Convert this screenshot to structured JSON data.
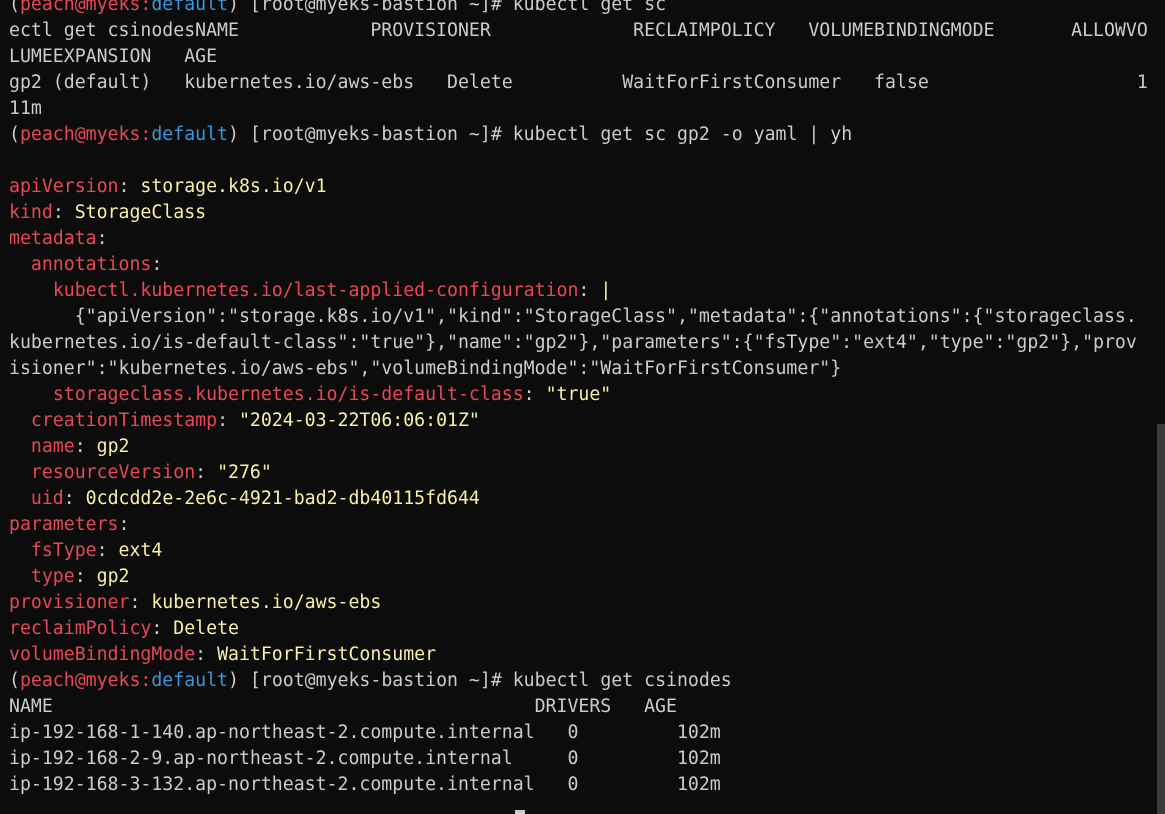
{
  "prompt": {
    "user": "peach",
    "at": "@",
    "host": "myeks",
    "colon": ":",
    "ns": "default",
    "shell": "[root@myeks-bastion ~]#"
  },
  "lines": [
    {
      "type": "prompt",
      "cmd": "kubectl get sc"
    },
    {
      "type": "plain",
      "text": "ectl get csinodesNAME            PROVISIONER             RECLAIMPOLICY   VOLUMEBINDINGMODE       ALLOWVO"
    },
    {
      "type": "plain",
      "text": "LUMEEXPANSION   AGE"
    },
    {
      "type": "plain",
      "text": "gp2 (default)   kubernetes.io/aws-ebs   Delete          WaitForFirstConsumer   false                   1"
    },
    {
      "type": "plain",
      "text": "11m"
    },
    {
      "type": "prompt",
      "cmd": "kubectl get sc gp2 -o yaml | yh"
    },
    {
      "type": "plain",
      "text": ""
    },
    {
      "type": "kv",
      "indent": "",
      "key": "apiVersion",
      "value": "storage.k8s.io/v1"
    },
    {
      "type": "kv",
      "indent": "",
      "key": "kind",
      "value": "StorageClass"
    },
    {
      "type": "kv",
      "indent": "",
      "key": "metadata",
      "value": ""
    },
    {
      "type": "kv",
      "indent": "  ",
      "key": "annotations",
      "value": ""
    },
    {
      "type": "kv",
      "indent": "    ",
      "key": "kubectl.kubernetes.io/last-applied-configuration",
      "value": "|"
    },
    {
      "type": "plain",
      "text": "      {\"apiVersion\":\"storage.k8s.io/v1\",\"kind\":\"StorageClass\",\"metadata\":{\"annotations\":{\"storageclass."
    },
    {
      "type": "plain",
      "text": "kubernetes.io/is-default-class\":\"true\"},\"name\":\"gp2\"},\"parameters\":{\"fsType\":\"ext4\",\"type\":\"gp2\"},\"prov"
    },
    {
      "type": "plain",
      "text": "isioner\":\"kubernetes.io/aws-ebs\",\"volumeBindingMode\":\"WaitForFirstConsumer\"}"
    },
    {
      "type": "kv",
      "indent": "    ",
      "key": "storageclass.kubernetes.io/is-default-class",
      "value": "\"true\""
    },
    {
      "type": "kv",
      "indent": "  ",
      "key": "creationTimestamp",
      "value": "\"2024-03-22T06:06:01Z\""
    },
    {
      "type": "kv",
      "indent": "  ",
      "key": "name",
      "value": "gp2"
    },
    {
      "type": "kv",
      "indent": "  ",
      "key": "resourceVersion",
      "value": "\"276\""
    },
    {
      "type": "kv",
      "indent": "  ",
      "key": "uid",
      "value": "0cdcdd2e-2e6c-4921-bad2-db40115fd644"
    },
    {
      "type": "kv",
      "indent": "",
      "key": "parameters",
      "value": ""
    },
    {
      "type": "kv",
      "indent": "  ",
      "key": "fsType",
      "value": "ext4"
    },
    {
      "type": "kv",
      "indent": "  ",
      "key": "type",
      "value": "gp2"
    },
    {
      "type": "kv",
      "indent": "",
      "key": "provisioner",
      "value": "kubernetes.io/aws-ebs"
    },
    {
      "type": "kv",
      "indent": "",
      "key": "reclaimPolicy",
      "value": "Delete"
    },
    {
      "type": "kv",
      "indent": "",
      "key": "volumeBindingMode",
      "value": "WaitForFirstConsumer"
    },
    {
      "type": "prompt",
      "cmd": "kubectl get csinodes"
    },
    {
      "type": "plain",
      "text": "NAME                                            DRIVERS   AGE"
    },
    {
      "type": "plain",
      "text": "ip-192-168-1-140.ap-northeast-2.compute.internal   0         102m"
    },
    {
      "type": "plain",
      "text": "ip-192-168-2-9.ap-northeast-2.compute.internal     0         102m"
    },
    {
      "type": "plain",
      "text": "ip-192-168-3-132.ap-northeast-2.compute.internal   0         102m"
    }
  ],
  "colors": {
    "background": "#0c0c0c",
    "text": "#cccccc",
    "prompt_user": "#e74856",
    "prompt_ns": "#3a96dd",
    "yaml_key": "#e74856",
    "yaml_value": "#f9f1a5"
  }
}
